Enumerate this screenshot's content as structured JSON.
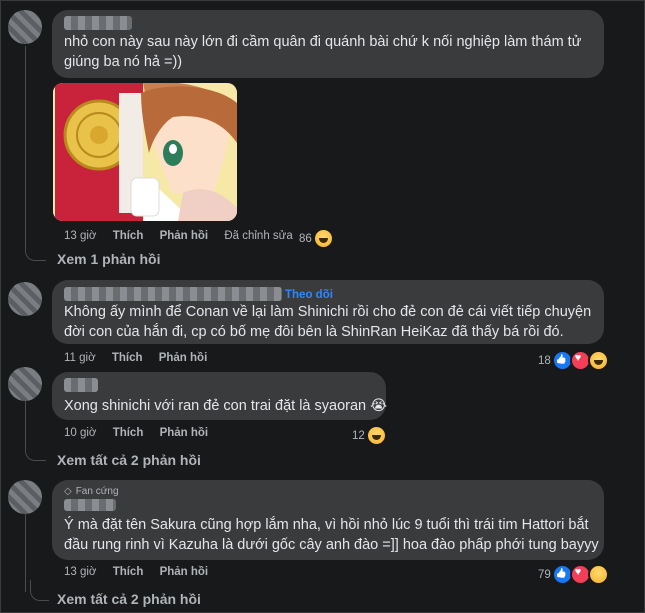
{
  "comments": [
    {
      "text_lines": [
        "nhỏ con này sau này lớn đi cầm quân đi quánh bài chứ k nối nghiệp làm thám tử",
        "giúng ba nó hả =))"
      ],
      "time": "13 giờ",
      "like": "Thích",
      "reply": "Phản hồi",
      "edited": "Đã chỉnh sửa",
      "reaction_count": "86",
      "reactions": [
        "haha"
      ],
      "view_replies": "Xem 1 phản hồi"
    },
    {
      "follow": "Theo dõi",
      "text_lines": [
        "Không ấy mình để Conan về lại làm Shinichi rồi cho đẻ con đẻ cái viết tiếp chuyện",
        "đời con của hắn đi, cp có bố mẹ đôi bên là ShinRan HeiKaz đã thấy bá rồi đó."
      ],
      "time": "11 giờ",
      "like": "Thích",
      "reply": "Phản hồi",
      "reaction_count": "18",
      "reactions": [
        "like",
        "love",
        "haha"
      ]
    },
    {
      "text_lines": [
        "Xong shinichi với ran đẻ con trai đặt là syaoran 😭"
      ],
      "time": "10 giờ",
      "like": "Thích",
      "reply": "Phản hồi",
      "reaction_count": "12",
      "reactions": [
        "haha"
      ],
      "view_replies": "Xem tất cả 2 phản hồi"
    },
    {
      "badge": "Fan cứng",
      "text_lines": [
        "Ý mà đặt tên Sakura cũng hợp lắm nha, vì hồi nhỏ lúc 9 tuổi thì trái tim Hattori bắt",
        "đầu rung rinh vì Kazuha là dưới gốc cây anh đào =]] hoa đào phấp phới tung bayyy"
      ],
      "time": "13 giờ",
      "like": "Thích",
      "reply": "Phản hồi",
      "reaction_count": "79",
      "reactions": [
        "like",
        "love",
        "care"
      ],
      "view_replies": "Xem tất cả 2 phản hồi"
    }
  ],
  "colors": {
    "background": "#18191a",
    "bubble": "#3a3b3c",
    "text": "#e4e6eb",
    "muted": "#b0b3b8",
    "link": "#2d88ff"
  }
}
